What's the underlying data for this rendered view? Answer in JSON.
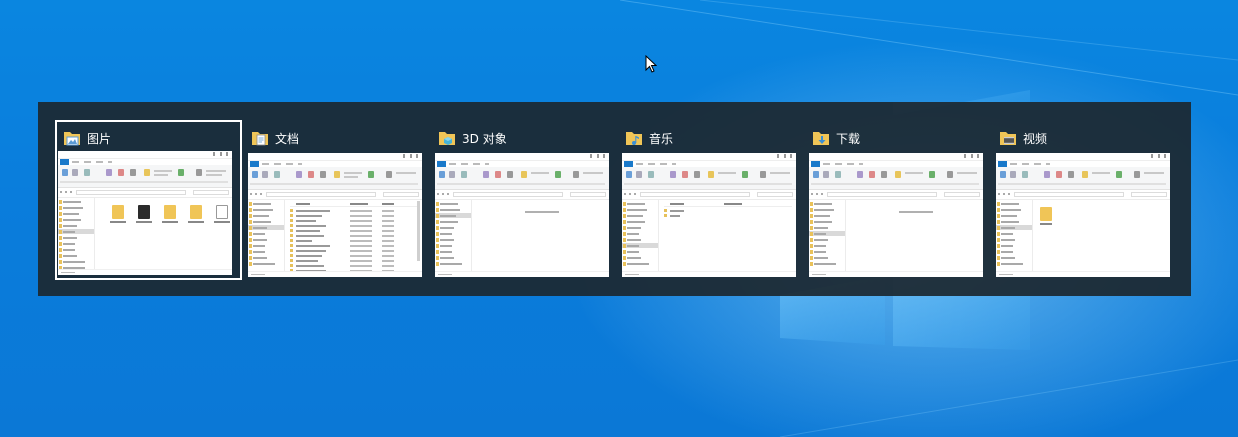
{
  "window_switcher": {
    "windows": [
      {
        "title": "图片",
        "icon": "pictures-folder-icon",
        "selected": true,
        "view": "icons"
      },
      {
        "title": "文档",
        "icon": "documents-folder-icon",
        "selected": false,
        "view": "details"
      },
      {
        "title": "3D 对象",
        "icon": "3d-objects-folder-icon",
        "selected": false,
        "view": "empty"
      },
      {
        "title": "音乐",
        "icon": "music-folder-icon",
        "selected": false,
        "view": "two-items"
      },
      {
        "title": "下载",
        "icon": "downloads-folder-icon",
        "selected": false,
        "view": "empty"
      },
      {
        "title": "视频",
        "icon": "videos-folder-icon",
        "selected": false,
        "view": "single-folder"
      }
    ]
  },
  "colors": {
    "desktop_blue": "#0a7ddc",
    "switcher_bg": "#1c2830",
    "selection_border": "#ffffff",
    "folder_yellow": "#f0c557",
    "explorer_file_tab": "#1979ca"
  }
}
